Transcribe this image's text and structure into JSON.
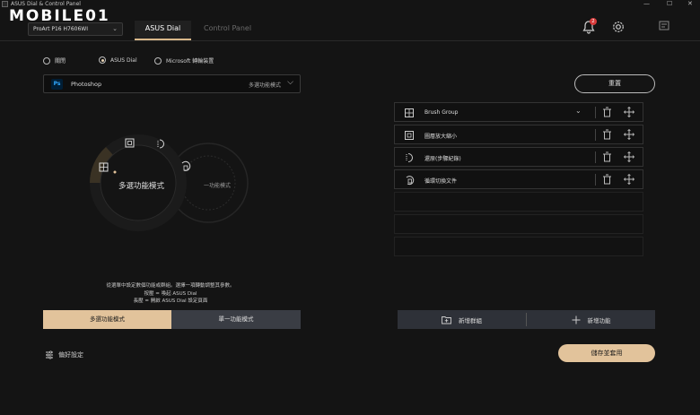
{
  "window": {
    "title": "ASUS Dial & Control Panel",
    "controls": [
      "—",
      "☐",
      "✕"
    ]
  },
  "logo": {
    "text": "MOBILE01"
  },
  "device": {
    "selected": "ProArt P16 H7606WI"
  },
  "tabs": [
    {
      "label": "ASUS Dial",
      "active": true
    },
    {
      "label": "Control Panel",
      "active": false
    }
  ],
  "header": {
    "notification_count": "2"
  },
  "modes": [
    {
      "label": "關閉",
      "selected": false
    },
    {
      "label": "ASUS Dial",
      "selected": true
    },
    {
      "label": "Microsoft 轉輪裝置",
      "selected": false
    }
  ],
  "app_select": {
    "icon_text": "Ps",
    "name": "Photoshop",
    "mode": "多選功能模式"
  },
  "dial": {
    "center_label": "多選功能模式",
    "side_label": "一功能模式"
  },
  "hints": {
    "line1": "從選單中設定數個功能或群組。選擇一項轉動調整其參數。",
    "line2": "按壓 = 喚起 ASUS Dial",
    "line3": "長壓 = 開啟 ASUS Dial 設定頁面"
  },
  "mode_buttons": {
    "multi": "多選功能模式",
    "single": "單一功能模式"
  },
  "preferences_label": "偏好設定",
  "reset_label": "重置",
  "functions": [
    {
      "label": "Brush Group",
      "icon": "grid-icon",
      "expandable": true
    },
    {
      "label": "圖層放大縮小",
      "icon": "zoom-frame-icon",
      "expandable": false
    },
    {
      "label": "還原(步驟紀錄)",
      "icon": "undo-steps-icon",
      "expandable": false
    },
    {
      "label": "循環切換文件",
      "icon": "cycle-docs-icon",
      "expandable": false
    }
  ],
  "bottom_buttons": {
    "add_group": "新增群組",
    "add_function": "新增功能"
  },
  "save_label": "儲存並套用",
  "colors": {
    "accent": "#e2c39b",
    "background": "#141414",
    "badge": "#d73b3b"
  }
}
